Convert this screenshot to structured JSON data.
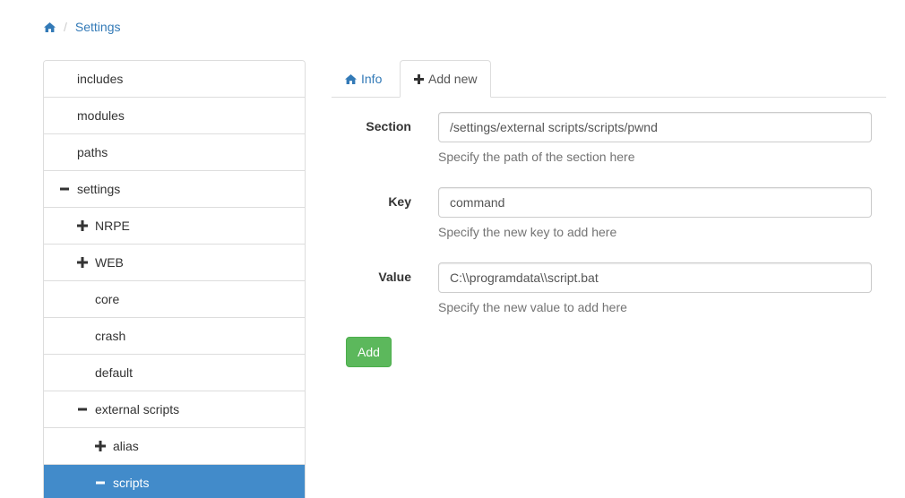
{
  "breadcrumb": {
    "home_icon": "home-icon",
    "separator": "/",
    "current": "Settings"
  },
  "tree": {
    "items": [
      {
        "label": "includes",
        "level": 0,
        "toggle": "none",
        "active": false
      },
      {
        "label": "modules",
        "level": 0,
        "toggle": "none",
        "active": false
      },
      {
        "label": "paths",
        "level": 0,
        "toggle": "none",
        "active": false
      },
      {
        "label": "settings",
        "level": 0,
        "toggle": "minus",
        "active": false
      },
      {
        "label": "NRPE",
        "level": 1,
        "toggle": "plus",
        "active": false
      },
      {
        "label": "WEB",
        "level": 1,
        "toggle": "plus",
        "active": false
      },
      {
        "label": "core",
        "level": 1,
        "toggle": "none",
        "active": false
      },
      {
        "label": "crash",
        "level": 1,
        "toggle": "none",
        "active": false
      },
      {
        "label": "default",
        "level": 1,
        "toggle": "none",
        "active": false
      },
      {
        "label": "external scripts",
        "level": 1,
        "toggle": "minus",
        "active": false
      },
      {
        "label": "alias",
        "level": 2,
        "toggle": "plus",
        "active": false
      },
      {
        "label": "scripts",
        "level": 2,
        "toggle": "minus",
        "active": true
      }
    ]
  },
  "tabs": {
    "info": {
      "label": "Info",
      "icon": "home-icon"
    },
    "add_new": {
      "label": "Add new",
      "icon": "plus-icon",
      "active": true
    }
  },
  "form": {
    "section": {
      "label": "Section",
      "value": "/settings/external scripts/scripts/pwnd",
      "help": "Specify the path of the section here"
    },
    "key": {
      "label": "Key",
      "value": "command",
      "help": "Specify the new key to add here"
    },
    "value": {
      "label": "Value",
      "value": "C:\\\\programdata\\\\script.bat",
      "help": "Specify the new value to add here"
    },
    "submit_label": "Add"
  },
  "colors": {
    "link": "#337ab7",
    "active_item": "#428bca",
    "success": "#5cb85c",
    "border": "#dddddd"
  }
}
